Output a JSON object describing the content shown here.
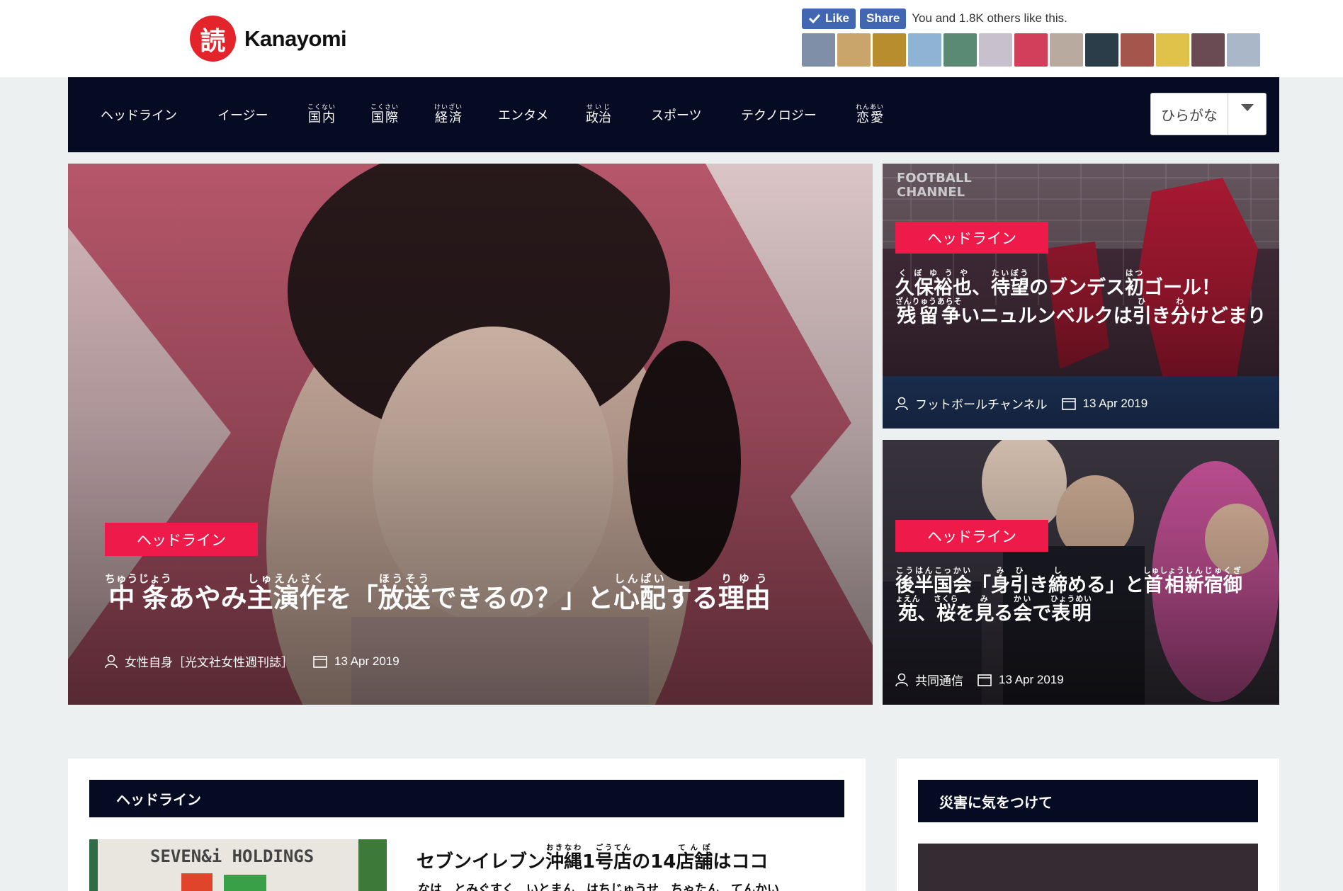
{
  "brand": {
    "name": "Kanayomi",
    "mark": "読"
  },
  "facebook": {
    "like_label": "Like",
    "share_label": "Share",
    "social_text": "You and 1.8K others like this.",
    "face_colors": [
      "#7f8fa7",
      "#c9a46b",
      "#b78d2e",
      "#8eb3d4",
      "#5a8a74",
      "#c8c0cc",
      "#d23f5a",
      "#b9aaa0",
      "#2c3d4a",
      "#a4564d",
      "#e0c24b",
      "#6b4b53",
      "#a9b7c9"
    ]
  },
  "nav": {
    "items": [
      {
        "label": "ヘッドライン",
        "ruby": ""
      },
      {
        "label": "イージー",
        "ruby": ""
      },
      {
        "label": "国内",
        "ruby": "こくない"
      },
      {
        "label": "国際",
        "ruby": "こくさい"
      },
      {
        "label": "経済",
        "ruby": "けいざい"
      },
      {
        "label": "エンタメ",
        "ruby": ""
      },
      {
        "label": "政治",
        "ruby": "せいじ"
      },
      {
        "label": "スポーツ",
        "ruby": ""
      },
      {
        "label": "テクノロジー",
        "ruby": ""
      },
      {
        "label": "恋愛",
        "ruby": "れんあい"
      }
    ],
    "lang_select": "ひらがな"
  },
  "hero": {
    "main": {
      "badge": "ヘッドライン",
      "title_parts": [
        {
          "t": "中条",
          "r": "ちゅうじょう"
        },
        {
          "t": "あやみ",
          "r": ""
        },
        {
          "t": "主演作",
          "r": "しゅえんさく"
        },
        {
          "t": "を「",
          "r": ""
        },
        {
          "t": "放送",
          "r": "ほうそう"
        },
        {
          "t": "できるの？」と",
          "r": ""
        },
        {
          "t": "心配",
          "r": "しんぱい"
        },
        {
          "t": "する",
          "r": ""
        },
        {
          "t": "理由",
          "r": "りゆう"
        }
      ],
      "author": "女性自身［光文社女性週刊誌］",
      "date": "13 Apr 2019"
    },
    "side1": {
      "badge": "ヘッドライン",
      "title_parts": [
        {
          "t": "久保裕也",
          "r": "くぼゆうや"
        },
        {
          "t": "、",
          "r": ""
        },
        {
          "t": "待望",
          "r": "たいぼう"
        },
        {
          "t": "のブンデス",
          "r": ""
        },
        {
          "t": "初",
          "r": "はつ"
        },
        {
          "t": "ゴール！",
          "r": ""
        },
        {
          "t": "残留争",
          "r": "ざんりゅうあらそ"
        },
        {
          "t": "いニュルンベルクは",
          "r": ""
        },
        {
          "t": "引",
          "r": "ひ"
        },
        {
          "t": "き",
          "r": ""
        },
        {
          "t": "分",
          "r": "わ"
        },
        {
          "t": "けどまり",
          "r": ""
        }
      ],
      "author": "フットボールチャンネル",
      "date": "13 Apr 2019"
    },
    "side2": {
      "badge": "ヘッドライン",
      "title_parts": [
        {
          "t": "後半国会",
          "r": "こうはんこっかい"
        },
        {
          "t": "「",
          "r": ""
        },
        {
          "t": "身引",
          "r": "みひ"
        },
        {
          "t": "き",
          "r": ""
        },
        {
          "t": "締",
          "r": "し"
        },
        {
          "t": "める」と",
          "r": ""
        },
        {
          "t": "首相",
          "r": "しゅしょう"
        },
        {
          "t": "新宿御苑",
          "r": "しんじゅくぎょえん"
        },
        {
          "t": "、",
          "r": ""
        },
        {
          "t": "桜",
          "r": "さくら"
        },
        {
          "t": "を",
          "r": ""
        },
        {
          "t": "見",
          "r": "み"
        },
        {
          "t": "る",
          "r": ""
        },
        {
          "t": "会",
          "r": "かい"
        },
        {
          "t": "で",
          "r": ""
        },
        {
          "t": "表明",
          "r": "ひょうめい"
        }
      ],
      "author": "共同通信",
      "date": "13 Apr 2019"
    }
  },
  "sections": {
    "left_title": "ヘッドライン",
    "right_title": "災害に気をつけて",
    "thumb_text": "SEVEN&i HOLDINGS",
    "article1_parts": [
      {
        "t": "セブンイレブン",
        "r": ""
      },
      {
        "t": "沖縄",
        "r": "おきなわ"
      },
      {
        "t": "1",
        "r": ""
      },
      {
        "t": "号店",
        "r": "ごうてん"
      },
      {
        "t": "の14",
        "r": ""
      },
      {
        "t": "店舗",
        "r": "てんぽ"
      },
      {
        "t": "はココ",
        "r": ""
      }
    ],
    "article1_sub": "なは　とみぐすく　いとまん　はちじゅうせ　ちゃたん　てんかい"
  }
}
